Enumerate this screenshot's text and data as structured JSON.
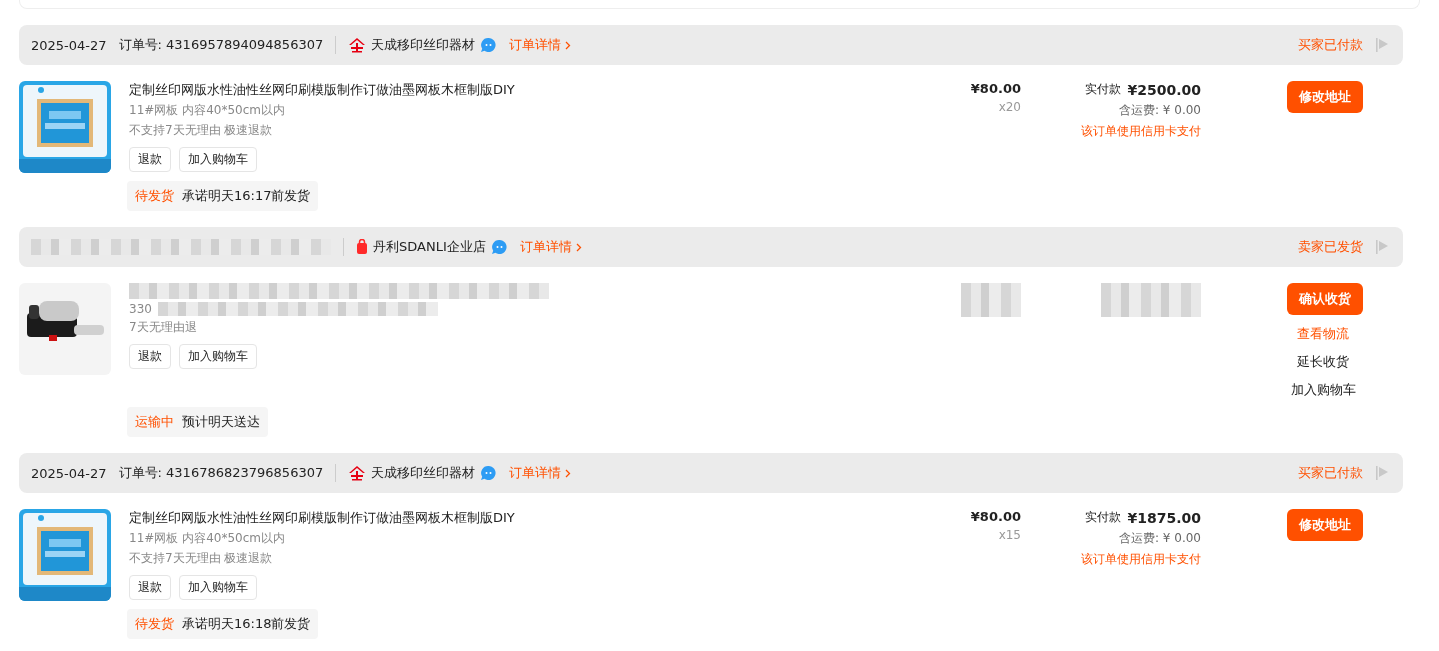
{
  "orders": [
    {
      "redacted": false,
      "date": "2025-04-27",
      "order_no": "订单号: 4316957894094856307",
      "shop": "天成移印丝印器材",
      "detail_link": "订单详情",
      "status": "买家已付款",
      "item": {
        "title": "定制丝印网版水性油性丝网印刷模版制作订做油墨网板木框制版DIY",
        "spec": "11#网板 内容40*50cm以内",
        "promise": "不支持7天无理由 极速退款",
        "buttons": [
          "退款",
          "加入购物车"
        ]
      },
      "unit_price": "¥80.00",
      "qty": "x20",
      "total_label": "实付款",
      "total": "¥2500.00",
      "shipping": "含运费: ¥ 0.00",
      "note": "该订单使用信用卡支付",
      "primary_action": "修改地址",
      "progress": {
        "state": "待发货",
        "text": "承诺明天16:17前发货"
      }
    },
    {
      "redacted": true,
      "shop": "丹利SDANLI企业店",
      "detail_link": "订单详情",
      "status": "卖家已发货",
      "item": {
        "spec": "330",
        "promise": "7天无理由退",
        "buttons": [
          "退款",
          "加入购物车"
        ]
      },
      "primary_action": "确认收货",
      "actions": [
        {
          "label": "查看物流",
          "accent": true
        },
        {
          "label": "延长收货",
          "accent": false
        },
        {
          "label": "加入购物车",
          "accent": false
        }
      ],
      "progress": {
        "state": "运输中",
        "text": "预计明天送达"
      }
    },
    {
      "redacted": false,
      "date": "2025-04-27",
      "order_no": "订单号: 4316786823796856307",
      "shop": "天成移印丝印器材",
      "detail_link": "订单详情",
      "status": "买家已付款",
      "item": {
        "title": "定制丝印网版水性油性丝网印刷模版制作订做油墨网板木框制版DIY",
        "spec": "11#网板 内容40*50cm以内",
        "promise": "不支持7天无理由 极速退款",
        "buttons": [
          "退款",
          "加入购物车"
        ]
      },
      "unit_price": "¥80.00",
      "qty": "x15",
      "total_label": "实付款",
      "total": "¥1875.00",
      "shipping": "含运费: ¥ 0.00",
      "note": "该订单使用信用卡支付",
      "primary_action": "修改地址",
      "progress": {
        "state": "待发货",
        "text": "承诺明天16:18前发货"
      }
    }
  ]
}
